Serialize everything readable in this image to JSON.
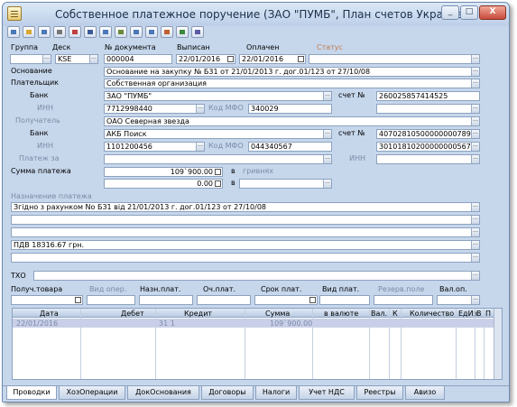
{
  "window": {
    "title": "Собственное платежное поручение (ЗАО \"ПУМБ\", План счетов Украина)",
    "btn_min": "_",
    "btn_max": "□",
    "btn_close": "X"
  },
  "header": {
    "group_label": "Группа",
    "desk_label": "Деск",
    "docnum_label": "№ документа",
    "issued_label": "Выписан",
    "paid_label": "Оплачен",
    "status_label": "Статус",
    "group_value": "",
    "desk_value": "KSE",
    "docnum_value": "000004",
    "issued_value": "22/01/2016",
    "paid_value": "22/01/2016",
    "status_value": ""
  },
  "basis": {
    "label": "Основание",
    "value": "Основание на закупку № Б31 от 21/01/2013 г. дог.01/123 от 27/10/08"
  },
  "payer": {
    "label": "Плательщик",
    "value": "Собственная организация",
    "bank_label": "Банк",
    "bank_value": "ЗАО \"ПУМБ\"",
    "account_label": "счет №",
    "account_value": "260025857414525",
    "inn_label": "ИНН",
    "inn_value": "7712998440",
    "mfo_label": "Код МФО",
    "mfo_value": "340029"
  },
  "receiver": {
    "label": "Получатель",
    "value": "ОАО Северная звезда",
    "bank_label": "Банк",
    "bank_value": "АКБ Поиск",
    "account_label": "счет №",
    "account_value": "40702810500000000789",
    "inn_label": "ИНН",
    "inn_value": "1101200456",
    "mfo_label": "Код МФО",
    "mfo_value": "044340567",
    "corr_value": "30101810200000000567"
  },
  "payment_for": {
    "label": "Платеж за",
    "inn_label": "ИНН"
  },
  "amount": {
    "label": "Сумма платежа",
    "value": "109`900.00",
    "in_label": "в",
    "currency": "гривнях",
    "value2": "0.00",
    "in2_label": "в"
  },
  "purpose": {
    "label": "Назначение платежа",
    "lines": [
      "Згідно з рахунком No Б31 від 21/01/2013 г. дог.01/123 от 27/10/08",
      "",
      "",
      "ПДВ 18316.67 грн.",
      "",
      ""
    ]
  },
  "tho": {
    "label": "ТХО"
  },
  "bottom": {
    "labels": [
      "Получ.товара",
      "Вид опер.",
      "Назн.плат.",
      "Оч.плат.",
      "Срок плат.",
      "Вид плат.",
      "Резерв.поле",
      "Вал.оп."
    ]
  },
  "table": {
    "columns": [
      "Дата",
      "Дебет",
      "Кредит",
      "Сумма",
      "в валюте",
      "Вал.",
      "К",
      "Количество",
      "ЕдИз",
      "В",
      "П"
    ],
    "row": {
      "date": "22/01/2016",
      "debit": "",
      "credit": "31 1",
      "sum": "109`900.00",
      "cur_sum": "",
      "cur": "",
      "k": "",
      "qty": "",
      "unit": "",
      "v": "",
      "p": ""
    }
  },
  "tabs": [
    "Проводки",
    "ХозОперации",
    "ДокОснования",
    "Договоры",
    "Налоги",
    "Учет НДС",
    "Реестры",
    "Авизо"
  ]
}
